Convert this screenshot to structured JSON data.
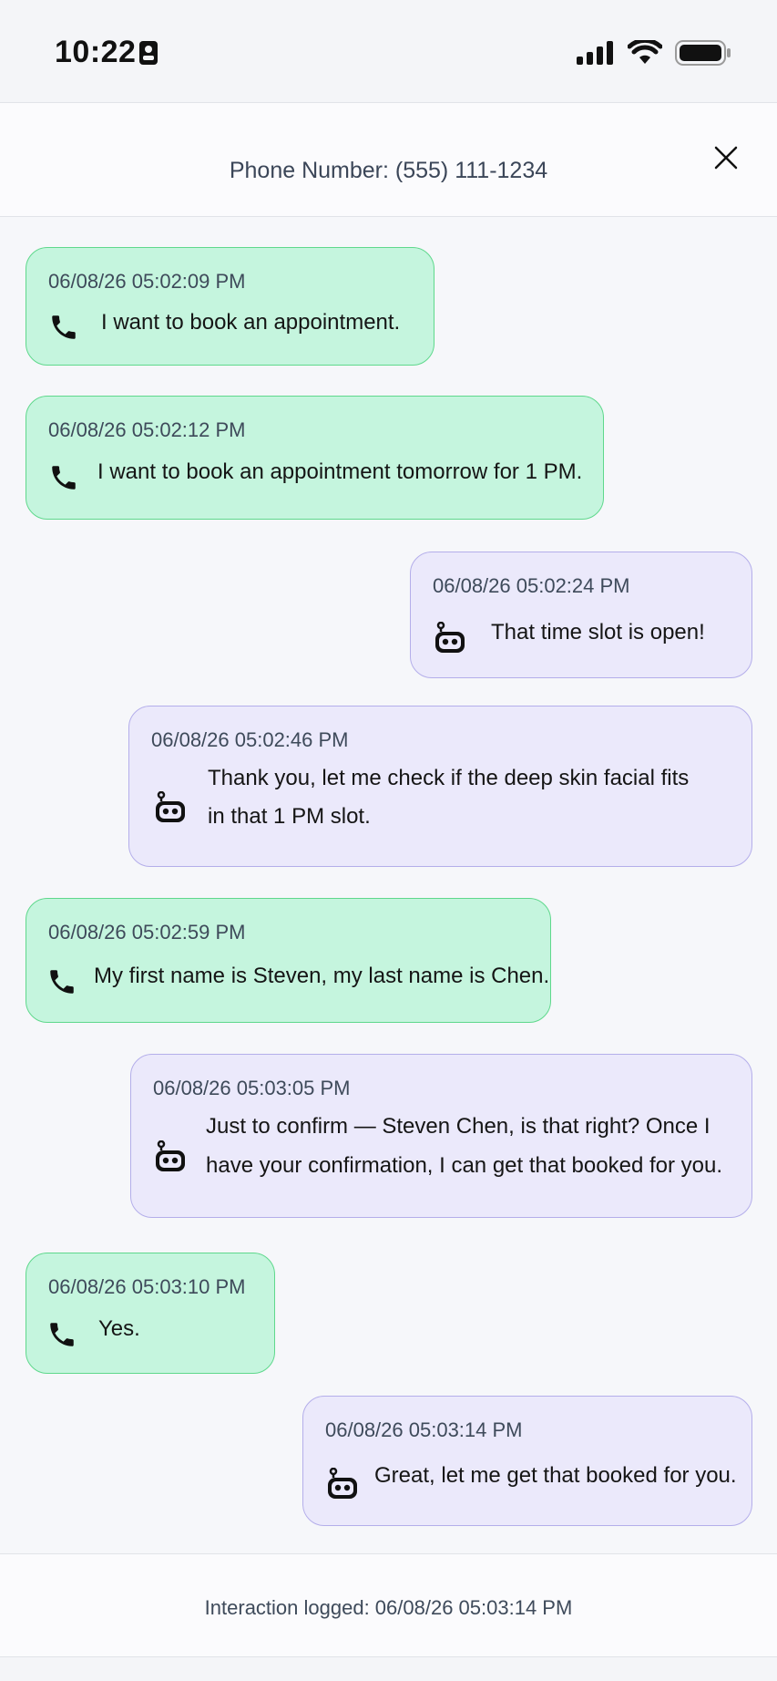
{
  "status_bar": {
    "time": "10:22"
  },
  "header": {
    "title": "Phone Number: (555) 111-1234"
  },
  "messages": [
    {
      "sender": "caller",
      "timestamp": "06/08/26 05:02:09 PM",
      "lines": [
        "I want to book an appointment."
      ]
    },
    {
      "sender": "caller",
      "timestamp": "06/08/26 05:02:12 PM",
      "lines": [
        "I want to book an appointment tomorrow for 1 PM."
      ]
    },
    {
      "sender": "bot",
      "timestamp": "06/08/26 05:02:24 PM",
      "lines": [
        "That time slot is open!"
      ]
    },
    {
      "sender": "bot",
      "timestamp": "06/08/26 05:02:46 PM",
      "lines": [
        "Thank you, let me check if the deep skin facial fits",
        "in that 1 PM slot."
      ]
    },
    {
      "sender": "caller",
      "timestamp": "06/08/26 05:02:59 PM",
      "lines": [
        "My first name is Steven, my last name is Chen."
      ]
    },
    {
      "sender": "bot",
      "timestamp": "06/08/26 05:03:05 PM",
      "lines": [
        "Just to confirm — Steven Chen, is that right? Once I",
        "have your confirmation, I can get that booked for you."
      ]
    },
    {
      "sender": "caller",
      "timestamp": "06/08/26 05:03:10 PM",
      "lines": [
        "Yes."
      ]
    },
    {
      "sender": "bot",
      "timestamp": "06/08/26 05:03:14 PM",
      "lines": [
        "Great, let me get that booked for you."
      ]
    }
  ],
  "footer": {
    "text": "Interaction logged: 06/08/26 05:03:14 PM"
  },
  "colors": {
    "caller_bubble": "#c5f5de",
    "caller_border": "#5fd88c",
    "bot_bubble": "#ebe9fb",
    "bot_border": "#b4aeea"
  },
  "icons": {
    "caller": "phone-icon",
    "bot": "robot-icon",
    "close": "close-icon"
  }
}
